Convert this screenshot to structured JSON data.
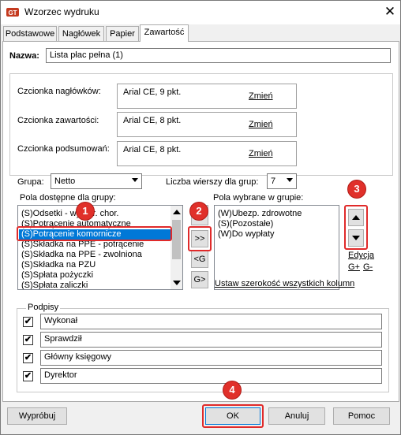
{
  "window": {
    "title": "Wzorzec wydruku",
    "close_glyph": "✕"
  },
  "tabs": [
    {
      "label": "Podstawowe"
    },
    {
      "label": "Nagłówek"
    },
    {
      "label": "Papier"
    },
    {
      "label": "Zawartość"
    }
  ],
  "name": {
    "label": "Nazwa:",
    "value": "Lista płac pełna (1)"
  },
  "fonts": {
    "header": {
      "label": "Czcionka nagłówków:",
      "value": "Arial CE, 9 pkt.",
      "change": "Zmień"
    },
    "content": {
      "label": "Czcionka zawartości:",
      "value": "Arial CE, 8 pkt.",
      "change": "Zmień"
    },
    "summary": {
      "label": "Czcionka podsumowań:",
      "value": "Arial CE, 8 pkt.",
      "change": "Zmień"
    }
  },
  "group": {
    "label": "Grupa:",
    "value": "Netto"
  },
  "rows_per_group": {
    "label": "Liczba wierszy dla grup:",
    "value": "7"
  },
  "available": {
    "label": "Pola dostępne dla grupy:",
    "items": [
      "(S)Odsetki - wyn.gr. chor.",
      "(S)Potrącenie automatyczne",
      "(S)Potrącenie komornicze",
      "(S)Składka na PPE - potrącenie",
      "(S)Składka na PPE - zwolniona",
      "(S)Składka na PZU",
      "(S)Spłata pożyczki",
      "(S)Spłata zaliczki"
    ],
    "selected_index": 2
  },
  "move_buttons": {
    "right": ">>",
    "left": "<G",
    "right_g": "G>"
  },
  "selected": {
    "label": "Pola wybrane w grupie:",
    "items": [
      "(W)Ubezp. zdrowotne",
      "(S)(Pozostałe)",
      "(W)Do wypłaty"
    ]
  },
  "edit_links": {
    "edycja": "Edycja",
    "gplus": "G+",
    "gminus": "G-"
  },
  "set_width_link": "Ustaw szerokość wszystkich kolumn",
  "signatures": {
    "label": "Podpisy",
    "items": [
      {
        "checked": true,
        "value": "Wykonał"
      },
      {
        "checked": true,
        "value": "Sprawdził"
      },
      {
        "checked": true,
        "value": "Główny księgowy"
      },
      {
        "checked": true,
        "value": "Dyrektor"
      }
    ],
    "check_glyph": "✔"
  },
  "buttons": {
    "test": "Wypróbuj",
    "ok": "OK",
    "cancel": "Anuluj",
    "help": "Pomoc"
  },
  "callouts": [
    "1",
    "2",
    "3",
    "4"
  ],
  "colors": {
    "selection": "#0078d7",
    "callout": "#e0302a"
  }
}
